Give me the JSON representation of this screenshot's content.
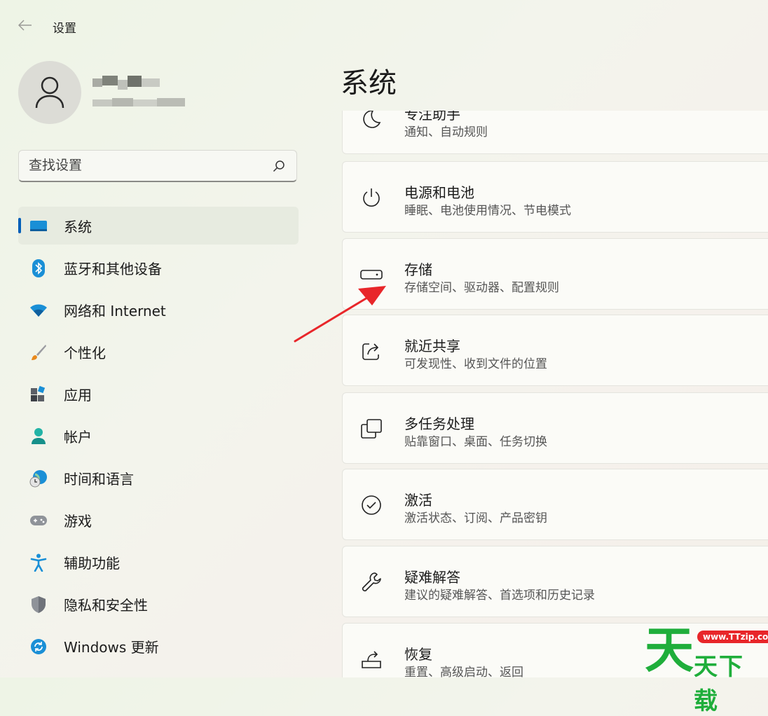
{
  "window": {
    "title": "设置"
  },
  "search": {
    "placeholder": "查找设置"
  },
  "nav": {
    "items": [
      {
        "label": "系统",
        "icon": "system-icon",
        "selected": true
      },
      {
        "label": "蓝牙和其他设备",
        "icon": "bluetooth-icon"
      },
      {
        "label": "网络和 Internet",
        "icon": "wifi-icon"
      },
      {
        "label": "个性化",
        "icon": "brush-icon"
      },
      {
        "label": "应用",
        "icon": "apps-icon"
      },
      {
        "label": "帐户",
        "icon": "account-icon"
      },
      {
        "label": "时间和语言",
        "icon": "globe-clock-icon"
      },
      {
        "label": "游戏",
        "icon": "gamepad-icon"
      },
      {
        "label": "辅助功能",
        "icon": "accessibility-icon"
      },
      {
        "label": "隐私和安全性",
        "icon": "shield-icon"
      },
      {
        "label": "Windows 更新",
        "icon": "update-icon"
      }
    ]
  },
  "main": {
    "title": "系统",
    "cards": [
      {
        "title": "专注助手",
        "subtitle": "通知、自动规则",
        "icon": "moon-icon"
      },
      {
        "title": "电源和电池",
        "subtitle": "睡眠、电池使用情况、节电模式",
        "icon": "power-icon"
      },
      {
        "title": "存储",
        "subtitle": "存储空间、驱动器、配置规则",
        "icon": "storage-icon"
      },
      {
        "title": "就近共享",
        "subtitle": "可发现性、收到文件的位置",
        "icon": "share-icon"
      },
      {
        "title": "多任务处理",
        "subtitle": "贴靠窗口、桌面、任务切换",
        "icon": "multitask-icon"
      },
      {
        "title": "激活",
        "subtitle": "激活状态、订阅、产品密钥",
        "icon": "check-circle-icon"
      },
      {
        "title": "疑难解答",
        "subtitle": "建议的疑难解答、首选项和历史记录",
        "icon": "wrench-icon"
      },
      {
        "title": "恢复",
        "subtitle": "重置、高级启动、返回",
        "icon": "recovery-icon"
      }
    ]
  },
  "watermark": {
    "big": "天",
    "small": "天下载",
    "url": "www.TTzip.com"
  },
  "colors": {
    "accent": "#005fb8",
    "annotation_arrow": "#e8262a",
    "watermark_green": "#1fae3b"
  }
}
